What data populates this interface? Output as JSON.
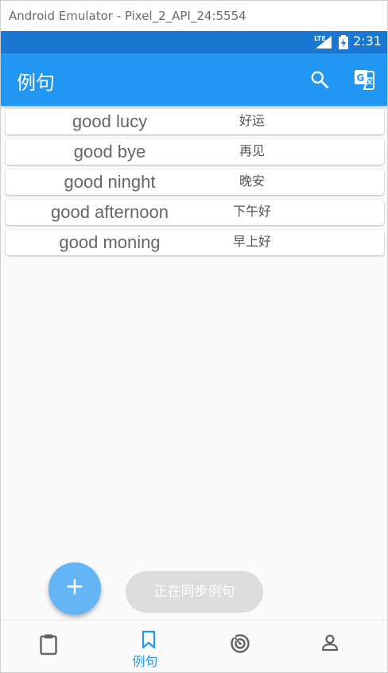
{
  "window": {
    "title": "Android Emulator - Pixel_2_API_24:5554"
  },
  "statusbar": {
    "network": "LTE",
    "time": "2:31"
  },
  "appbar": {
    "title": "例句"
  },
  "examples": [
    {
      "en": "good lucy",
      "zh": "好运"
    },
    {
      "en": "good bye",
      "zh": "再见"
    },
    {
      "en": "good ninght",
      "zh": "晚安"
    },
    {
      "en": "good afternoon",
      "zh": "下午好"
    },
    {
      "en": "good moning",
      "zh": "早上好"
    }
  ],
  "fab": {
    "label": "+"
  },
  "toast": {
    "text": "正在同步例句"
  },
  "bottom_nav": {
    "active_label": "例句",
    "items": [
      "clipboard-icon",
      "bookmark-icon",
      "radar-icon",
      "person-icon"
    ]
  },
  "colors": {
    "primary": "#2196f3",
    "status": "#1976d2",
    "fab": "#64b5f6"
  }
}
